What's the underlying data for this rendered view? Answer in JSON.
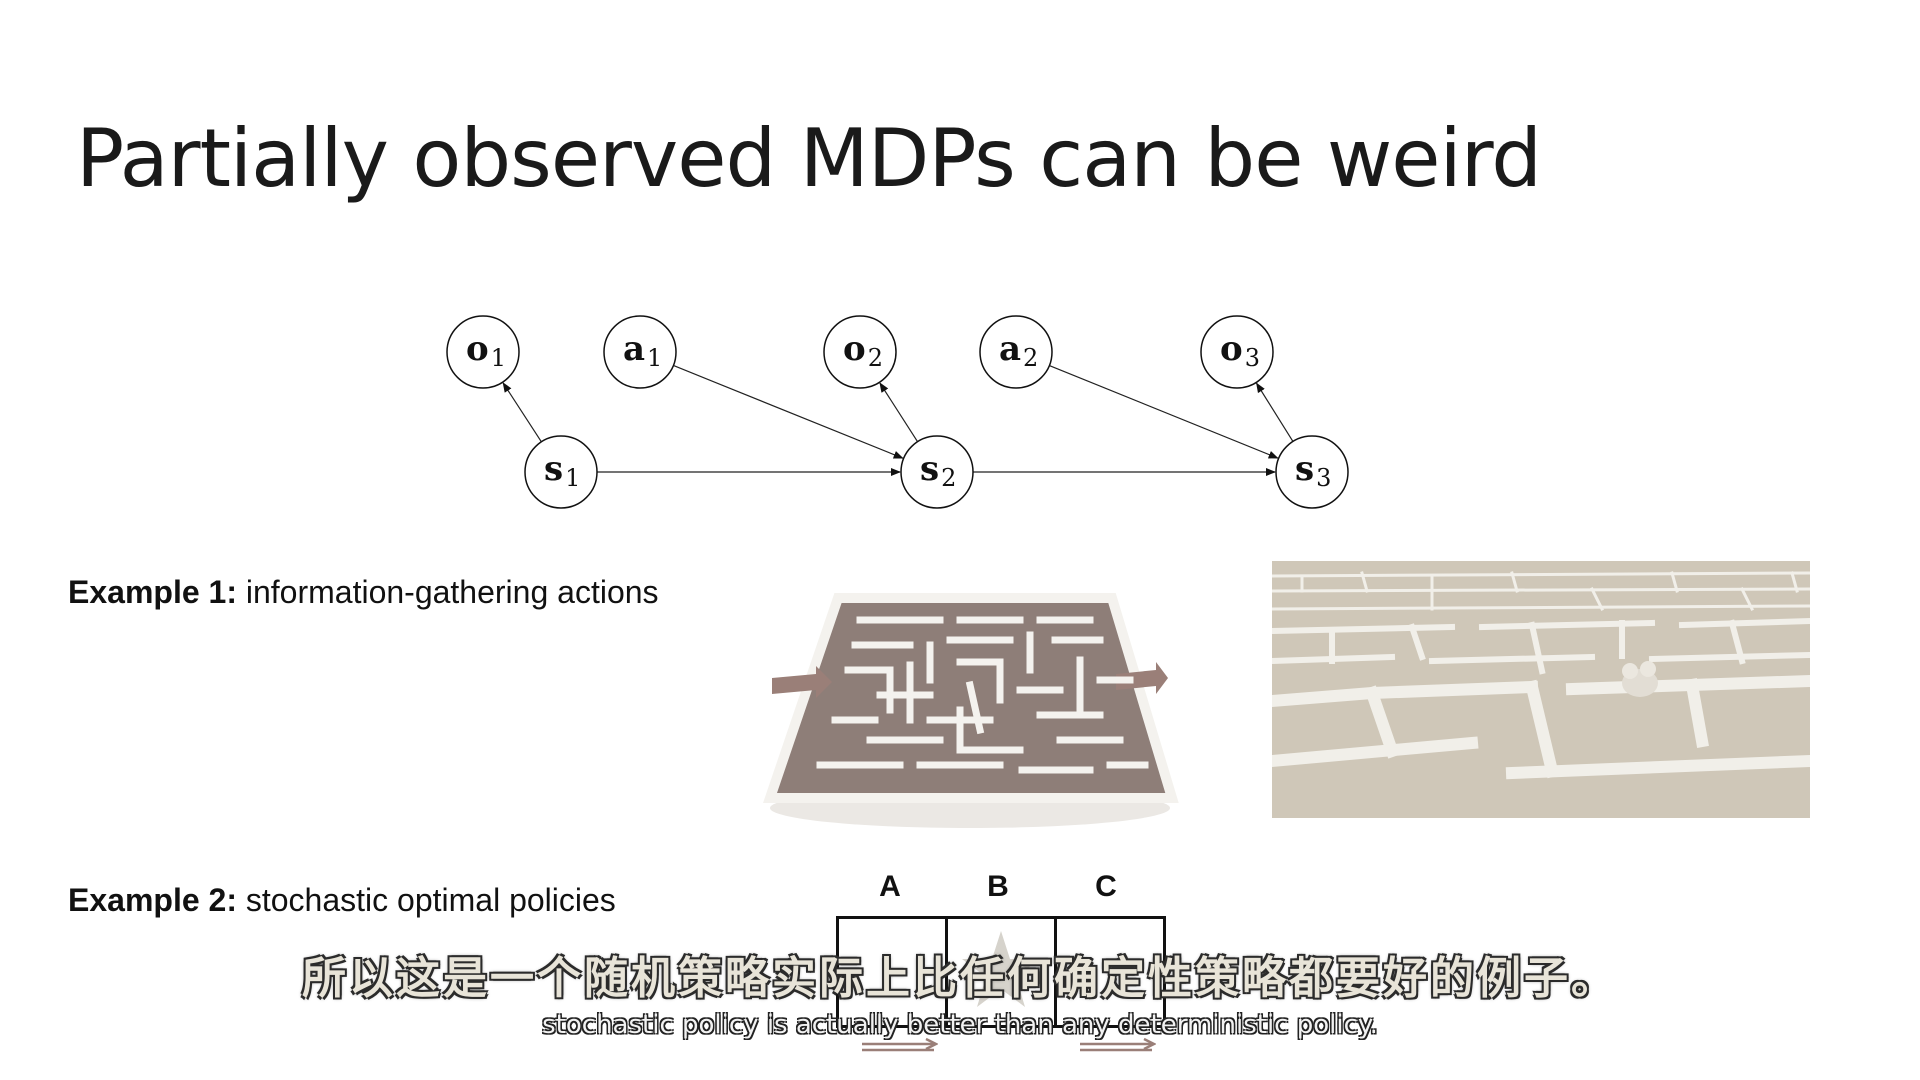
{
  "slide": {
    "title": "Partially observed MDPs can be weird",
    "example1": {
      "label": "Example 1:",
      "text": "information-gathering actions"
    },
    "example2": {
      "label": "Example 2:",
      "text": "stochastic optimal policies"
    },
    "grid": {
      "columns": [
        "A",
        "B",
        "C"
      ]
    }
  },
  "graph": {
    "nodes": [
      {
        "id": "o1",
        "symbol": "o",
        "sub": "1"
      },
      {
        "id": "a1",
        "symbol": "a",
        "sub": "1"
      },
      {
        "id": "o2",
        "symbol": "o",
        "sub": "2"
      },
      {
        "id": "a2",
        "symbol": "a",
        "sub": "2"
      },
      {
        "id": "o3",
        "symbol": "o",
        "sub": "3"
      },
      {
        "id": "s1",
        "symbol": "s",
        "sub": "1"
      },
      {
        "id": "s2",
        "symbol": "s",
        "sub": "2"
      },
      {
        "id": "s3",
        "symbol": "s",
        "sub": "3"
      }
    ],
    "edges": [
      [
        "s1",
        "o1"
      ],
      [
        "s2",
        "o2"
      ],
      [
        "s3",
        "o3"
      ],
      [
        "s1",
        "s2"
      ],
      [
        "s2",
        "s3"
      ],
      [
        "a1",
        "s2"
      ],
      [
        "a2",
        "s3"
      ]
    ]
  },
  "subtitles": {
    "zh": "所以这是一个随机策略实际上比任何确定性策略都要好的例子。",
    "en": "stochastic policy is actually better than any deterministic policy."
  },
  "colors": {
    "maze_wall_top": "#f4f2ee",
    "maze_floor": "#8e7e78",
    "arrow": "#9a7f78"
  }
}
